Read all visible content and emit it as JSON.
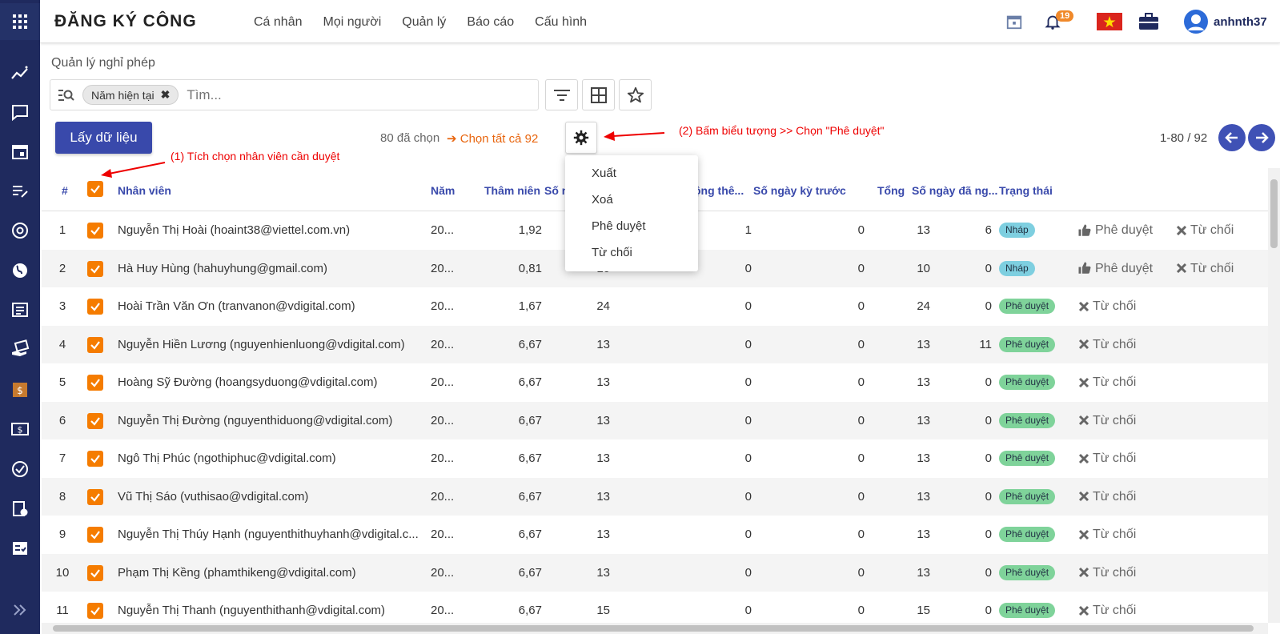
{
  "app_title": "ĐĂNG KÝ CÔNG",
  "nav": [
    "Cá nhân",
    "Mọi người",
    "Quản lý",
    "Báo cáo",
    "Cấu hình"
  ],
  "header": {
    "notif_count": "19",
    "username": "anhnth37"
  },
  "breadcrumb": "Quản lý nghỉ phép",
  "search": {
    "chip": "Năm hiện tại",
    "placeholder": "Tìm..."
  },
  "toolbar": {
    "fetch_label": "Lấy dữ liệu",
    "selected": "80 đã chọn",
    "select_all": "Chọn tất cả 92",
    "pager": "1-80 / 92"
  },
  "annotations": {
    "step1": "(1) Tích chọn nhân viên cần duyệt",
    "step2": "(2) Bấm biểu tượng >> Chọn \"Phê duyệt\""
  },
  "menu": [
    "Xuất",
    "Xoá",
    "Phê duyệt",
    "Từ chối"
  ],
  "columns": {
    "idx": "#",
    "employee": "Nhân viên",
    "year": "Năm",
    "seniority": "Thâm niên",
    "days": "Số n",
    "bonus": "ộng thê...",
    "prev": "Số ngày kỳ trước",
    "total": "Tổng",
    "used": "Số ngày đã ng...",
    "status": "Trạng thái"
  },
  "actions": {
    "approve": "Phê duyệt",
    "reject": "Từ chối"
  },
  "rows": [
    {
      "n": "1",
      "name": "Nguyễn Thị Hoài (hoaint38@viettel.com.vn)",
      "year": "20...",
      "sen": "1,92",
      "days": "",
      "bonus": "1",
      "prev": "0",
      "total": "13",
      "used": "6",
      "status": "Nháp",
      "draft": true
    },
    {
      "n": "2",
      "name": "Hà Huy Hùng (hahuyhung@gmail.com)",
      "year": "20...",
      "sen": "0,81",
      "days": "10",
      "bonus": "0",
      "prev": "0",
      "total": "10",
      "used": "0",
      "status": "Nháp",
      "draft": true
    },
    {
      "n": "3",
      "name": "Hoài Trần Văn Ơn (tranvanon@vdigital.com)",
      "year": "20...",
      "sen": "1,67",
      "days": "24",
      "bonus": "0",
      "prev": "0",
      "total": "24",
      "used": "0",
      "status": "Phê duyệt",
      "draft": false
    },
    {
      "n": "4",
      "name": "Nguyễn Hiền Lương (nguyenhienluong@vdigital.com)",
      "year": "20...",
      "sen": "6,67",
      "days": "13",
      "bonus": "0",
      "prev": "0",
      "total": "13",
      "used": "11",
      "status": "Phê duyệt",
      "draft": false
    },
    {
      "n": "5",
      "name": "Hoàng Sỹ Đường (hoangsyduong@vdigital.com)",
      "year": "20...",
      "sen": "6,67",
      "days": "13",
      "bonus": "0",
      "prev": "0",
      "total": "13",
      "used": "0",
      "status": "Phê duyệt",
      "draft": false
    },
    {
      "n": "6",
      "name": "Nguyễn Thị Đường (nguyenthiduong@vdigital.com)",
      "year": "20...",
      "sen": "6,67",
      "days": "13",
      "bonus": "0",
      "prev": "0",
      "total": "13",
      "used": "0",
      "status": "Phê duyệt",
      "draft": false
    },
    {
      "n": "7",
      "name": "Ngô Thị Phúc (ngothiphuc@vdigital.com)",
      "year": "20...",
      "sen": "6,67",
      "days": "13",
      "bonus": "0",
      "prev": "0",
      "total": "13",
      "used": "0",
      "status": "Phê duyệt",
      "draft": false
    },
    {
      "n": "8",
      "name": "Vũ Thị Sáo (vuthisao@vdigital.com)",
      "year": "20...",
      "sen": "6,67",
      "days": "13",
      "bonus": "0",
      "prev": "0",
      "total": "13",
      "used": "0",
      "status": "Phê duyệt",
      "draft": false
    },
    {
      "n": "9",
      "name": "Nguyễn Thị Thúy Hạnh (nguyenthithuyhanh@vdigital.c...",
      "year": "20...",
      "sen": "6,67",
      "days": "13",
      "bonus": "0",
      "prev": "0",
      "total": "13",
      "used": "0",
      "status": "Phê duyệt",
      "draft": false
    },
    {
      "n": "10",
      "name": "Phạm Thị Kềng (phamthikeng@vdigital.com)",
      "year": "20...",
      "sen": "6,67",
      "days": "13",
      "bonus": "0",
      "prev": "0",
      "total": "13",
      "used": "0",
      "status": "Phê duyệt",
      "draft": false
    },
    {
      "n": "11",
      "name": "Nguyễn Thị Thanh (nguyenthithanh@vdigital.com)",
      "year": "20...",
      "sen": "6,67",
      "days": "15",
      "bonus": "0",
      "prev": "0",
      "total": "15",
      "used": "0",
      "status": "Phê duyệt",
      "draft": false
    }
  ],
  "colors": {
    "primary": "#3949ab",
    "sidebar": "#1f2a5e",
    "accent": "#f57c00",
    "annotation": "#e00000"
  }
}
